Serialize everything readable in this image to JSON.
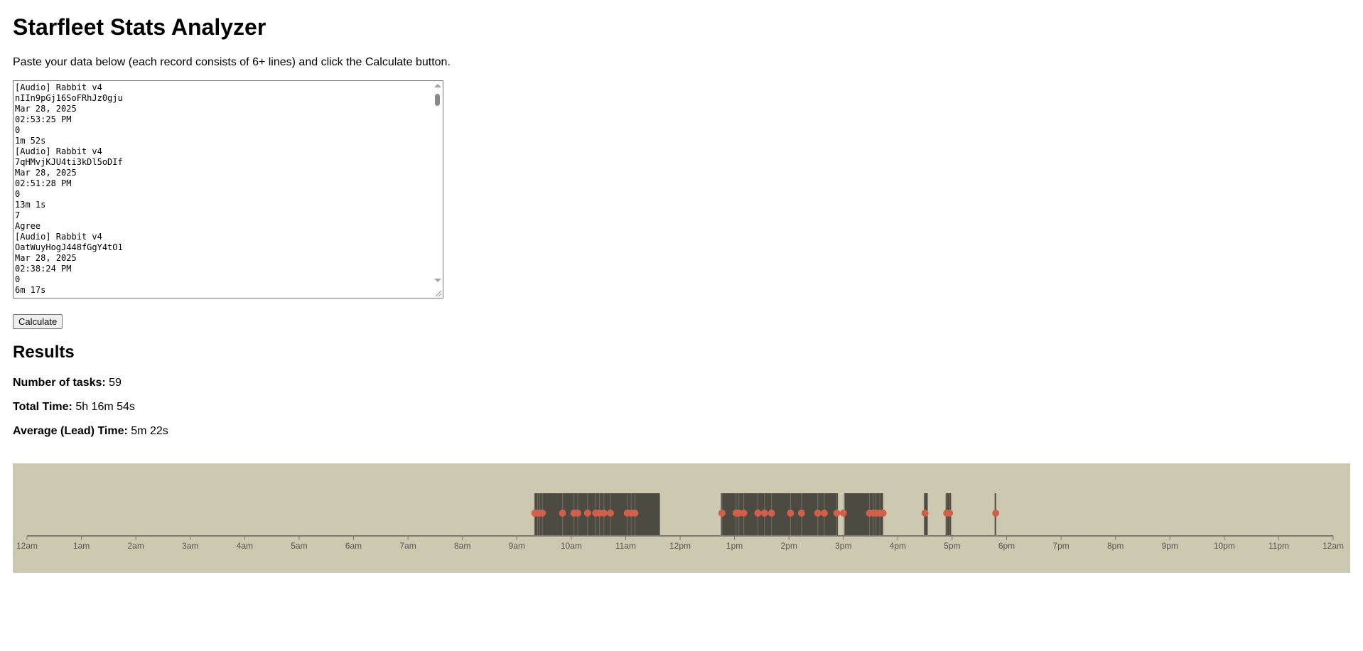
{
  "app": {
    "title": "Starfleet Stats Analyzer",
    "instructions": "Paste your data below (each record consists of 6+ lines) and click the Calculate button."
  },
  "input": {
    "value": "[Audio] Rabbit v4\nnIIn9pGj16SoFRhJz0gju\nMar 28, 2025\n02:53:25 PM\n0\n1m 52s\n[Audio] Rabbit v4\n7qHMvjKJU4ti3kDl5oDIf\nMar 28, 2025\n02:51:28 PM\n0\n13m 1s\n7\nAgree\n[Audio] Rabbit v4\nOatWuyHogJ448fGgY4tO1\nMar 28, 2025\n02:38:24 PM\n0\n6m 17s"
  },
  "actions": {
    "calculate_label": "Calculate"
  },
  "results": {
    "heading": "Results",
    "tasks_label": "Number of tasks:",
    "tasks_value": "59",
    "total_label": "Total Time:",
    "total_value": "5h 16m 54s",
    "avg_label": "Average (Lead) Time:",
    "avg_value": "5m 22s"
  },
  "colors": {
    "timeline_background": "#cdc8b0",
    "task_block": "#4d4a42",
    "task_marker": "#d0604a",
    "axis": "#7a7a72",
    "tick_label": "#555555"
  },
  "chart_data": {
    "type": "timeline",
    "x_axis_unit": "hour of day",
    "xlim": [
      0,
      24
    ],
    "tick_labels": [
      "12am",
      "1am",
      "2am",
      "3am",
      "4am",
      "5am",
      "6am",
      "7am",
      "8am",
      "9am",
      "10am",
      "11am",
      "12pm",
      "1pm",
      "2pm",
      "3pm",
      "4pm",
      "5pm",
      "6pm",
      "7pm",
      "8pm",
      "9pm",
      "10pm",
      "11pm",
      "12am"
    ],
    "busy_intervals_hours": [
      [
        9.32,
        11.63
      ],
      [
        12.75,
        14.9
      ],
      [
        15.02,
        15.73
      ],
      [
        16.48,
        16.55
      ],
      [
        16.88,
        16.98
      ],
      [
        17.78,
        17.81
      ]
    ],
    "task_start_hours": [
      9.33,
      9.38,
      9.42,
      9.47,
      9.84,
      10.05,
      10.12,
      10.3,
      10.45,
      10.52,
      10.6,
      10.72,
      11.03,
      11.1,
      11.17,
      12.77,
      13.03,
      13.08,
      13.17,
      13.43,
      13.55,
      13.68,
      14.03,
      14.23,
      14.53,
      14.65,
      14.88,
      15.0,
      15.48,
      15.55,
      15.6,
      15.67,
      15.73,
      16.5,
      16.9,
      16.95,
      17.8
    ]
  }
}
